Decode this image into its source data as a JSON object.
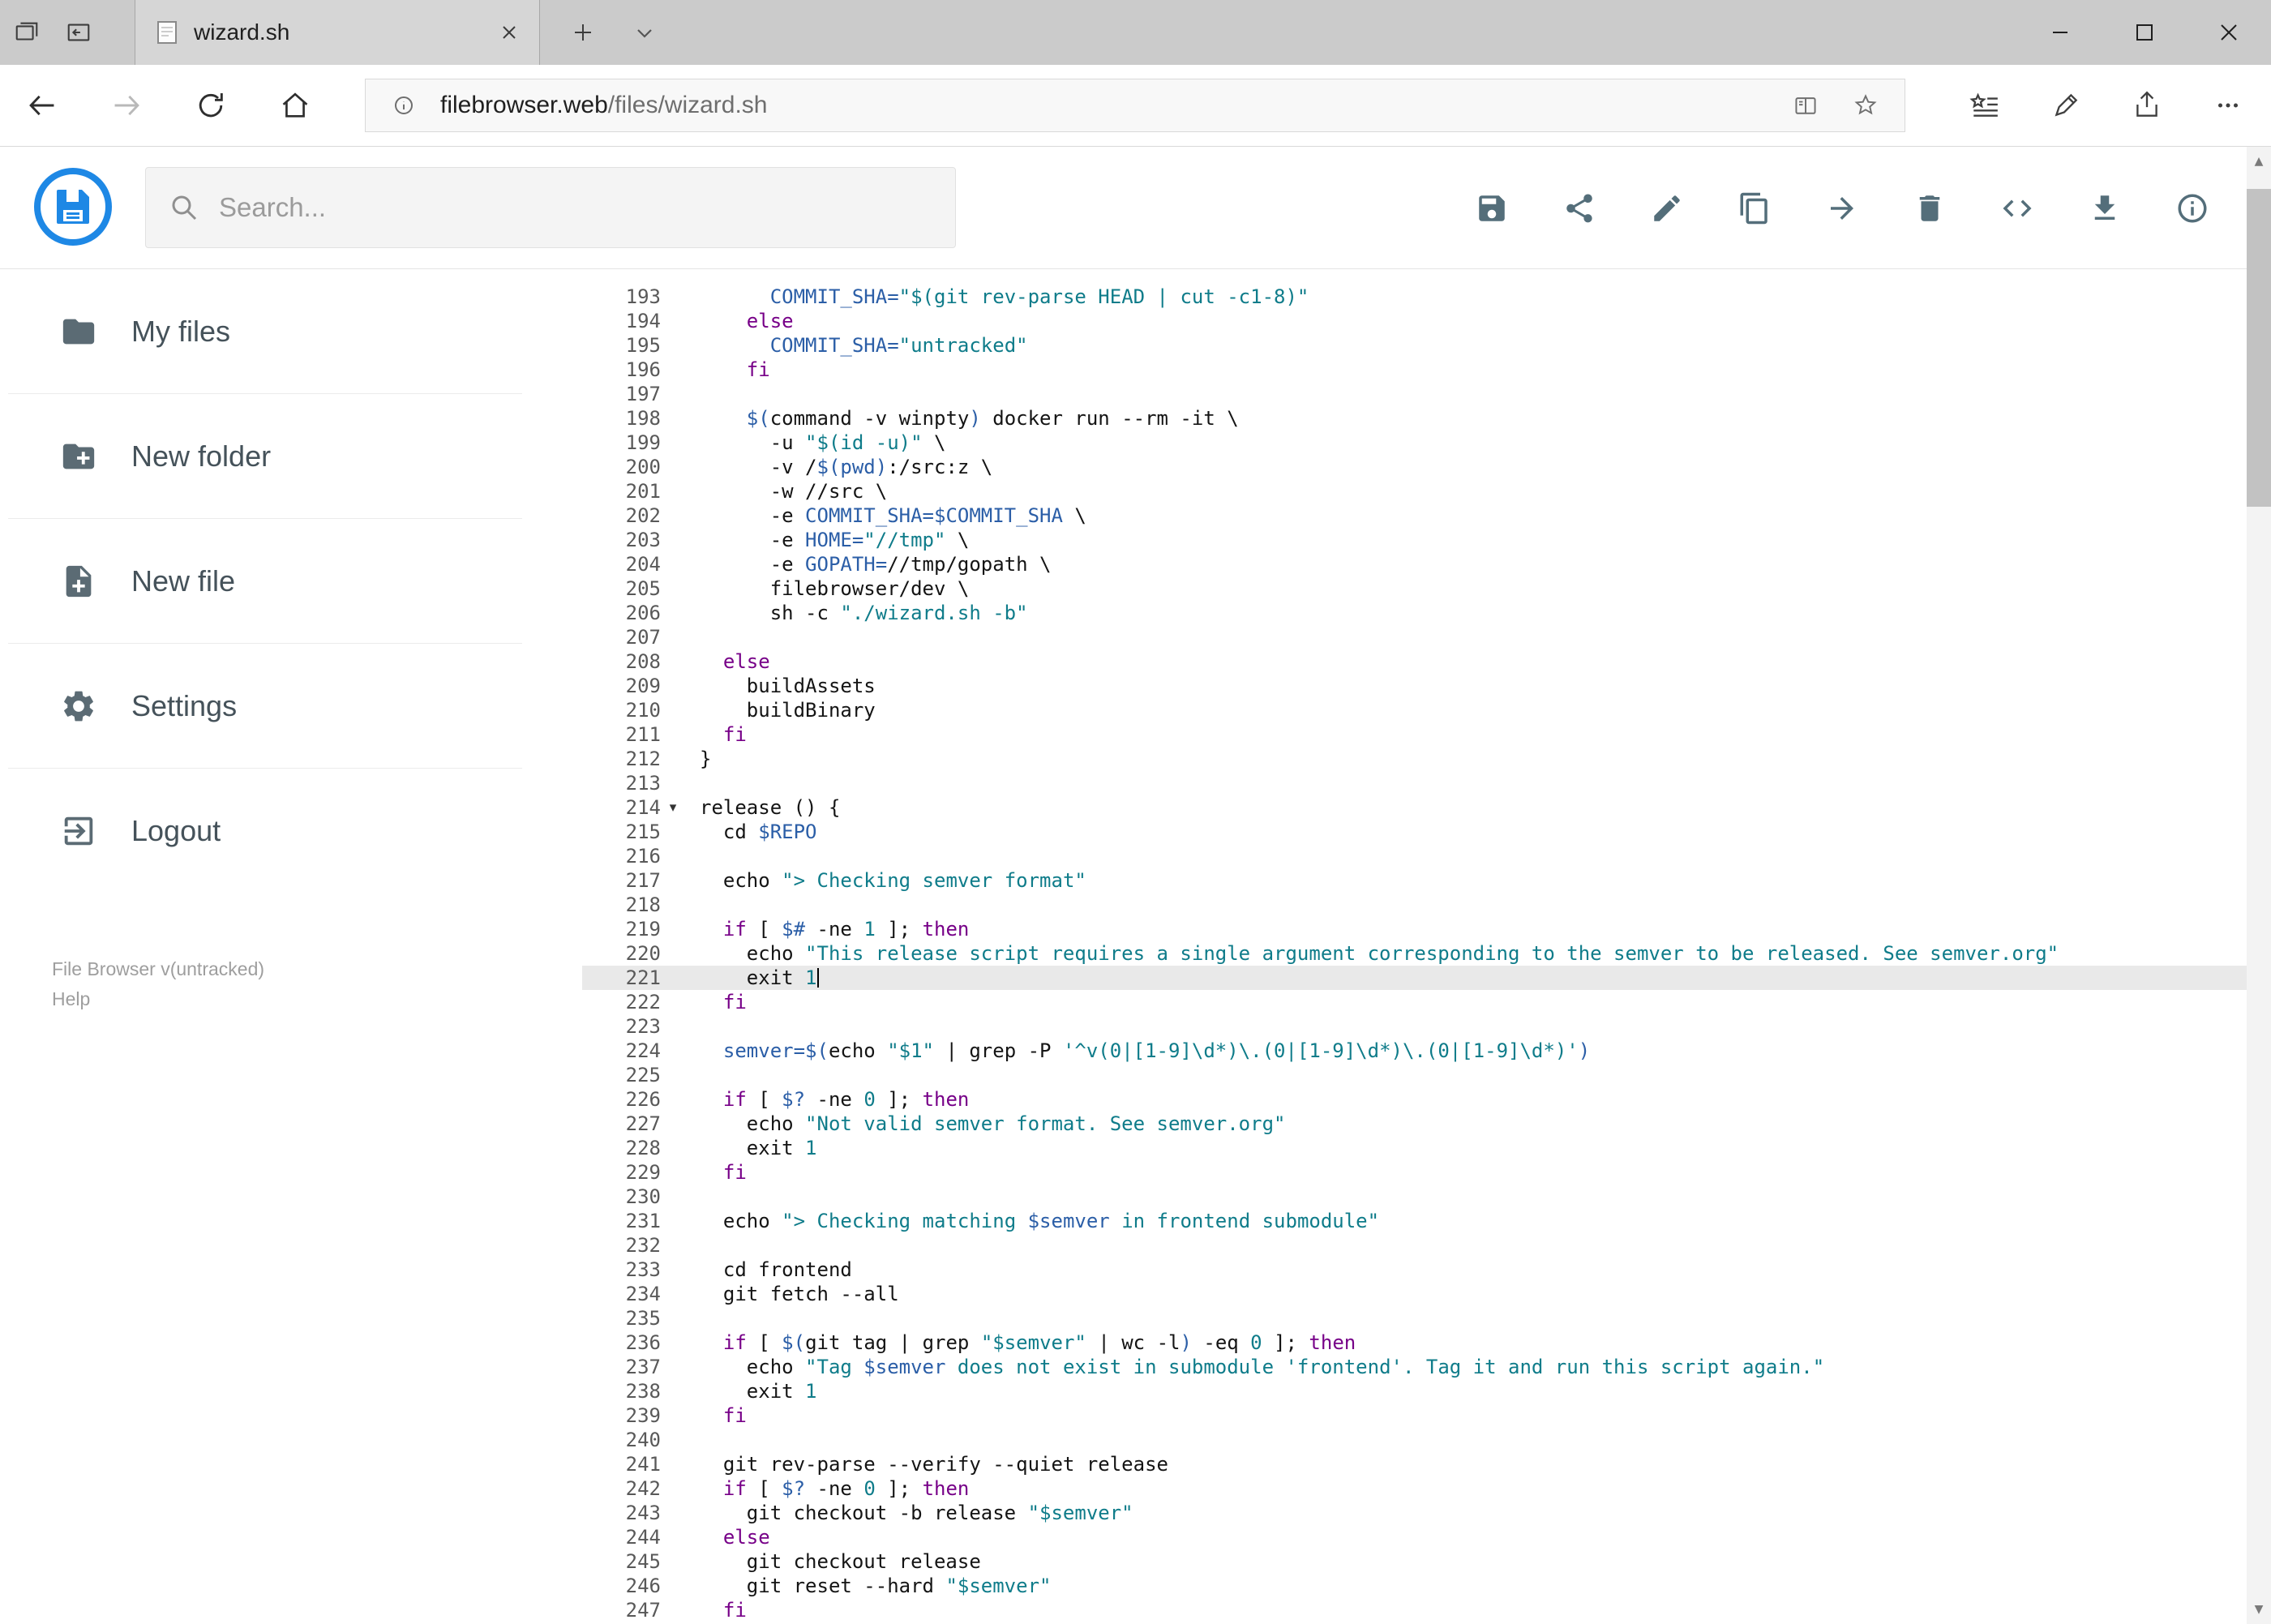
{
  "browser": {
    "tab_title": "wizard.sh",
    "url_domain": "filebrowser.web",
    "url_path": "/files/wizard.sh",
    "tabbar_icons": [
      "set-tabs-aside-icon",
      "tabs-preview-icon",
      "page-icon",
      "tab-close-icon",
      "new-tab-icon",
      "tab-list-chevron-icon",
      "minimize-icon",
      "maximize-icon",
      "close-icon"
    ],
    "nav_icons": [
      "back-icon",
      "forward-icon",
      "refresh-icon",
      "home-icon",
      "page-info-icon",
      "reading-view-icon",
      "favorite-star-icon",
      "hub-icon",
      "web-note-icon",
      "share-icon",
      "more-icon"
    ]
  },
  "header": {
    "search_placeholder": "Search...",
    "toolbar_icons": [
      "save-icon",
      "share-icon",
      "rename-icon",
      "copy-icon",
      "move-icon",
      "delete-icon",
      "raw-view-icon",
      "download-icon",
      "info-icon"
    ]
  },
  "sidebar": {
    "items": [
      {
        "label": "My files",
        "icon": "folder-icon"
      },
      {
        "label": "New folder",
        "icon": "new-folder-icon"
      },
      {
        "label": "New file",
        "icon": "new-file-icon"
      },
      {
        "label": "Settings",
        "icon": "settings-gear-icon"
      },
      {
        "label": "Logout",
        "icon": "logout-icon"
      }
    ],
    "footer_version": "File Browser v(untracked)",
    "footer_help": "Help"
  },
  "colors": {
    "accent_blue": "#1e88e5",
    "icon_slate": "#546e7a",
    "active_line_bg": "#e9e9e9",
    "token_plain": "#141414",
    "token_keyword": "#770088",
    "token_string": "#0f7c8a",
    "token_variable": "#2b5ea7",
    "token_number": "#0f7c8a"
  },
  "editor": {
    "first_line": 193,
    "active_line": 221,
    "cursor_line": 221,
    "fold_marker_line": 214,
    "fold_icon": "▾",
    "lines": [
      {
        "n": 193,
        "t": [
          [
            "p",
            "      "
          ],
          [
            "v",
            "COMMIT_SHA="
          ],
          [
            "s",
            "\"$(git rev-parse HEAD | cut -c1-8)\""
          ]
        ]
      },
      {
        "n": 194,
        "t": [
          [
            "p",
            "    "
          ],
          [
            "k",
            "else"
          ]
        ]
      },
      {
        "n": 195,
        "t": [
          [
            "p",
            "      "
          ],
          [
            "v",
            "COMMIT_SHA="
          ],
          [
            "s",
            "\"untracked\""
          ]
        ]
      },
      {
        "n": 196,
        "t": [
          [
            "p",
            "    "
          ],
          [
            "k",
            "fi"
          ]
        ]
      },
      {
        "n": 197,
        "t": []
      },
      {
        "n": 198,
        "t": [
          [
            "p",
            "    "
          ],
          [
            "v",
            "$("
          ],
          [
            "p",
            "command -v winpty"
          ],
          [
            "v",
            ")"
          ],
          [
            "p",
            " docker run --rm -it \\"
          ]
        ]
      },
      {
        "n": 199,
        "t": [
          [
            "p",
            "      -u "
          ],
          [
            "s",
            "\"$(id -u)\""
          ],
          [
            "p",
            " \\"
          ]
        ]
      },
      {
        "n": 200,
        "t": [
          [
            "p",
            "      -v /"
          ],
          [
            "v",
            "$(pwd)"
          ],
          [
            "p",
            ":/src:z \\"
          ]
        ]
      },
      {
        "n": 201,
        "t": [
          [
            "p",
            "      -w //src \\"
          ]
        ]
      },
      {
        "n": 202,
        "t": [
          [
            "p",
            "      -e "
          ],
          [
            "v",
            "COMMIT_SHA=$COMMIT_SHA"
          ],
          [
            "p",
            " \\"
          ]
        ]
      },
      {
        "n": 203,
        "t": [
          [
            "p",
            "      -e "
          ],
          [
            "v",
            "HOME="
          ],
          [
            "s",
            "\"//tmp\""
          ],
          [
            "p",
            " \\"
          ]
        ]
      },
      {
        "n": 204,
        "t": [
          [
            "p",
            "      -e "
          ],
          [
            "v",
            "GOPATH="
          ],
          [
            "p",
            "//tmp/gopath \\"
          ]
        ]
      },
      {
        "n": 205,
        "t": [
          [
            "p",
            "      filebrowser/dev \\"
          ]
        ]
      },
      {
        "n": 206,
        "t": [
          [
            "p",
            "      sh -c "
          ],
          [
            "s",
            "\"./wizard.sh -b\""
          ]
        ]
      },
      {
        "n": 207,
        "t": []
      },
      {
        "n": 208,
        "t": [
          [
            "p",
            "  "
          ],
          [
            "k",
            "else"
          ]
        ]
      },
      {
        "n": 209,
        "t": [
          [
            "p",
            "    buildAssets"
          ]
        ]
      },
      {
        "n": 210,
        "t": [
          [
            "p",
            "    buildBinary"
          ]
        ]
      },
      {
        "n": 211,
        "t": [
          [
            "p",
            "  "
          ],
          [
            "k",
            "fi"
          ]
        ]
      },
      {
        "n": 212,
        "t": [
          [
            "p",
            "}"
          ]
        ]
      },
      {
        "n": 213,
        "t": []
      },
      {
        "n": 214,
        "t": [
          [
            "p",
            "release () {"
          ]
        ]
      },
      {
        "n": 215,
        "t": [
          [
            "p",
            "  cd "
          ],
          [
            "v",
            "$REPO"
          ]
        ]
      },
      {
        "n": 216,
        "t": []
      },
      {
        "n": 217,
        "t": [
          [
            "p",
            "  echo "
          ],
          [
            "s",
            "\"> Checking semver format\""
          ]
        ]
      },
      {
        "n": 218,
        "t": []
      },
      {
        "n": 219,
        "t": [
          [
            "p",
            "  "
          ],
          [
            "k",
            "if"
          ],
          [
            "p",
            " [ "
          ],
          [
            "v",
            "$#"
          ],
          [
            "p",
            " -ne "
          ],
          [
            "n",
            "1"
          ],
          [
            "p",
            " ]; "
          ],
          [
            "k",
            "then"
          ]
        ]
      },
      {
        "n": 220,
        "t": [
          [
            "p",
            "    echo "
          ],
          [
            "s",
            "\"This release script requires a single argument corresponding to the semver to be released. See semver.org\""
          ]
        ]
      },
      {
        "n": 221,
        "t": [
          [
            "p",
            "    exit "
          ],
          [
            "n",
            "1"
          ]
        ]
      },
      {
        "n": 222,
        "t": [
          [
            "p",
            "  "
          ],
          [
            "k",
            "fi"
          ]
        ]
      },
      {
        "n": 223,
        "t": []
      },
      {
        "n": 224,
        "t": [
          [
            "p",
            "  "
          ],
          [
            "v",
            "semver=$("
          ],
          [
            "p",
            "echo "
          ],
          [
            "s",
            "\"$1\""
          ],
          [
            "p",
            " | grep -P "
          ],
          [
            "s",
            "'^v(0|[1-9]\\d*)\\.(0|[1-9]\\d*)\\.(0|[1-9]\\d*)'"
          ],
          [
            "v",
            ")"
          ]
        ]
      },
      {
        "n": 225,
        "t": []
      },
      {
        "n": 226,
        "t": [
          [
            "p",
            "  "
          ],
          [
            "k",
            "if"
          ],
          [
            "p",
            " [ "
          ],
          [
            "v",
            "$?"
          ],
          [
            "p",
            " -ne "
          ],
          [
            "n",
            "0"
          ],
          [
            "p",
            " ]; "
          ],
          [
            "k",
            "then"
          ]
        ]
      },
      {
        "n": 227,
        "t": [
          [
            "p",
            "    echo "
          ],
          [
            "s",
            "\"Not valid semver format. See semver.org\""
          ]
        ]
      },
      {
        "n": 228,
        "t": [
          [
            "p",
            "    exit "
          ],
          [
            "n",
            "1"
          ]
        ]
      },
      {
        "n": 229,
        "t": [
          [
            "p",
            "  "
          ],
          [
            "k",
            "fi"
          ]
        ]
      },
      {
        "n": 230,
        "t": []
      },
      {
        "n": 231,
        "t": [
          [
            "p",
            "  echo "
          ],
          [
            "s",
            "\"> Checking matching "
          ],
          [
            "v",
            "$semver"
          ],
          [
            "s",
            " in frontend submodule\""
          ]
        ]
      },
      {
        "n": 232,
        "t": []
      },
      {
        "n": 233,
        "t": [
          [
            "p",
            "  cd frontend"
          ]
        ]
      },
      {
        "n": 234,
        "t": [
          [
            "p",
            "  git fetch --all"
          ]
        ]
      },
      {
        "n": 235,
        "t": []
      },
      {
        "n": 236,
        "t": [
          [
            "p",
            "  "
          ],
          [
            "k",
            "if"
          ],
          [
            "p",
            " [ "
          ],
          [
            "v",
            "$("
          ],
          [
            "p",
            "git tag | grep "
          ],
          [
            "s",
            "\"$semver\""
          ],
          [
            "p",
            " | wc -l"
          ],
          [
            "v",
            ")"
          ],
          [
            "p",
            " -eq "
          ],
          [
            "n",
            "0"
          ],
          [
            "p",
            " ]; "
          ],
          [
            "k",
            "then"
          ]
        ]
      },
      {
        "n": 237,
        "t": [
          [
            "p",
            "    echo "
          ],
          [
            "s",
            "\"Tag "
          ],
          [
            "v",
            "$semver"
          ],
          [
            "s",
            " does not exist in submodule 'frontend'. Tag it and run this script again.\""
          ]
        ]
      },
      {
        "n": 238,
        "t": [
          [
            "p",
            "    exit "
          ],
          [
            "n",
            "1"
          ]
        ]
      },
      {
        "n": 239,
        "t": [
          [
            "p",
            "  "
          ],
          [
            "k",
            "fi"
          ]
        ]
      },
      {
        "n": 240,
        "t": []
      },
      {
        "n": 241,
        "t": [
          [
            "p",
            "  git rev-parse --verify --quiet release"
          ]
        ]
      },
      {
        "n": 242,
        "t": [
          [
            "p",
            "  "
          ],
          [
            "k",
            "if"
          ],
          [
            "p",
            " [ "
          ],
          [
            "v",
            "$?"
          ],
          [
            "p",
            " -ne "
          ],
          [
            "n",
            "0"
          ],
          [
            "p",
            " ]; "
          ],
          [
            "k",
            "then"
          ]
        ]
      },
      {
        "n": 243,
        "t": [
          [
            "p",
            "    git checkout -b release "
          ],
          [
            "s",
            "\"$semver\""
          ]
        ]
      },
      {
        "n": 244,
        "t": [
          [
            "p",
            "  "
          ],
          [
            "k",
            "else"
          ]
        ]
      },
      {
        "n": 245,
        "t": [
          [
            "p",
            "    git checkout release"
          ]
        ]
      },
      {
        "n": 246,
        "t": [
          [
            "p",
            "    git reset --hard "
          ],
          [
            "s",
            "\"$semver\""
          ]
        ]
      },
      {
        "n": 247,
        "t": [
          [
            "p",
            "  "
          ],
          [
            "k",
            "fi"
          ]
        ]
      }
    ]
  }
}
